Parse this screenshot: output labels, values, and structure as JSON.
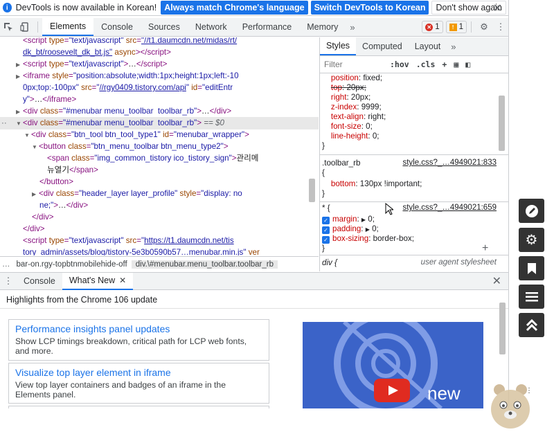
{
  "infobar": {
    "message": "DevTools is now available in Korean!",
    "buttons": [
      "Always match Chrome's language",
      "Switch DevTools to Korean",
      "Don't show again"
    ]
  },
  "main_tabs": [
    "Elements",
    "Console",
    "Sources",
    "Network",
    "Performance",
    "Memory"
  ],
  "badges": {
    "errors": "1",
    "warnings": "1"
  },
  "dom": {
    "l1_src": "\"//t1.daumcdn.net/midas/rt/",
    "l2_src": "dk_bt/roosevelt_dk_bt.js\"",
    "l4_style": "\"position:absolute;width:1px;height:1px;left:-10",
    "l5_style": "0px;top:-100px\"",
    "l5_src": "//rgy0409.tistory.com/api",
    "l5_id": "\"editEntr",
    "l6_id": "y\"",
    "l7_class": "\"#menubar menu_toolbar  toolbar_rb\"",
    "l8_class": "\"#menubar menu_toolbar  toolbar_rb\"",
    "l8_eq": "== $0",
    "l9_class": "\"btn_tool btn_tool_type1\"",
    "l9_id": "\"menubar_wrapper\"",
    "l10_class": "\"btn_menu_toolbar btn_menu_type2\"",
    "l11_class": "\"img_common_tistory ico_tistory_sign\"",
    "l11_text": "관리메",
    "l12_text": "뉴열기",
    "l14_class": "\"header_layer layer_profile\"",
    "l14_style": "\"display: no",
    "l15_text": "ne;\"",
    "l18_src": "https://t1.daumcdn.net/tis",
    "l19_src": "tory_admin/assets/blog/tistory-5e3b0590b57…menubar.min.js\"",
    "l19_tail": " ver"
  },
  "breadcrumbs": [
    "bar-on.rgy-topbtnmobilehide-off",
    "div.\\#menubar.menu_toolbar.toolbar_rb"
  ],
  "styles_tabs": [
    "Styles",
    "Computed",
    "Layout"
  ],
  "filter": {
    "placeholder": "Filter",
    "hov": ":hov",
    "cls": ".cls"
  },
  "rules": {
    "r1": [
      {
        "name": "position",
        "value": "fixed;"
      },
      {
        "name": "top",
        "value": "20px;",
        "struck": true
      },
      {
        "name": "right",
        "value": "20px;"
      },
      {
        "name": "z-index",
        "value": "9999;"
      },
      {
        "name": "text-align",
        "value": "right;"
      },
      {
        "name": "font-size",
        "value": "0;"
      },
      {
        "name": "line-height",
        "value": "0;"
      }
    ],
    "r2_selector": ".toolbar_rb",
    "r2_source": "style.css?_…4949021:833",
    "r2_prop": "bottom",
    "r2_value": "130px !important;",
    "r3_selector": "* {",
    "r3_source": "style.css?_…4949021:659",
    "r3_props": [
      {
        "name": "margin",
        "value": "0;"
      },
      {
        "name": "padding",
        "value": "0;"
      },
      {
        "name": "box-sizing",
        "value": "border-box;"
      }
    ],
    "r4_selector": "div {",
    "r4_source": "user agent stylesheet"
  },
  "drawer": {
    "tabs": [
      "Console",
      "What's New"
    ]
  },
  "whatsnew": {
    "heading": "Highlights from the Chrome 106 update",
    "cards": [
      {
        "title": "Performance insights panel updates",
        "desc": "Show LCP timings breakdown, critical path for LCP web fonts, and more."
      },
      {
        "title": "Visualize top layer element in iframe",
        "desc": "View top layer containers and badges of an iframe in the Elements panel."
      }
    ],
    "video_text": "new"
  },
  "side_buttons": [
    "pen-icon",
    "gear-icon",
    "bookmark-icon",
    "menu-icon",
    "double-up-icon"
  ]
}
